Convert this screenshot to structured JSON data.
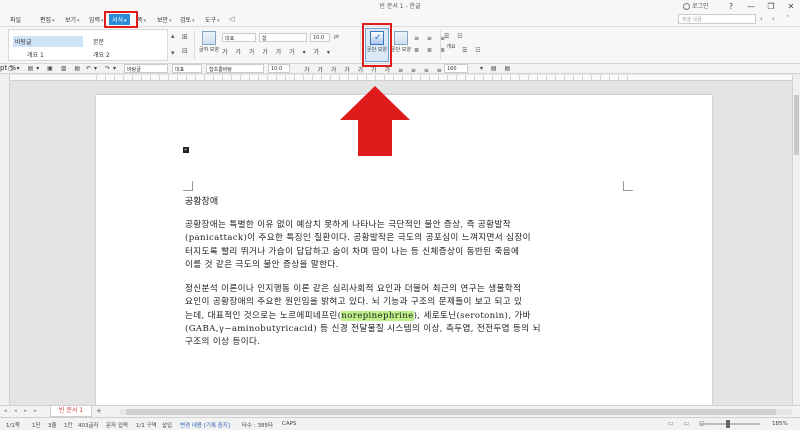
{
  "titlebar": {
    "title": "빈 문서 1 - 한글",
    "login": "로그인",
    "buttons": [
      "?",
      "—",
      "❐",
      "✕"
    ]
  },
  "menubar": {
    "items": [
      {
        "label": "파일",
        "arrow": false,
        "active": false
      },
      {
        "label": "편집",
        "arrow": true,
        "active": false
      },
      {
        "label": "보기",
        "arrow": true,
        "active": false
      },
      {
        "label": "입력",
        "arrow": true,
        "active": false
      },
      {
        "label": "서식",
        "arrow": true,
        "active": true
      },
      {
        "label": "쪽",
        "arrow": true,
        "active": false
      },
      {
        "label": "보안",
        "arrow": true,
        "active": false
      },
      {
        "label": "검토",
        "arrow": true,
        "active": false
      },
      {
        "label": "도구",
        "arrow": true,
        "active": false
      }
    ],
    "search_placeholder": "찾을 내용"
  },
  "ribbon": {
    "styles": [
      {
        "label": "바탕글",
        "selected": true
      },
      {
        "label": "본문",
        "selected": false
      },
      {
        "label": "개요 1",
        "selected": false
      },
      {
        "label": "개요 2",
        "selected": false
      }
    ],
    "char_label": "글자 모양",
    "font_lang": "대표",
    "font_name": "함",
    "font_size": "10.0",
    "font_unit": "pt",
    "para_btn": "문단 모양",
    "para_btn2": "문단 모양",
    "style_btn": "스타일",
    "style_btn2": "개요"
  },
  "fmtbar": {
    "style": "바탕글",
    "lang": "대표",
    "font": "함초롬바탕",
    "size": "10.0",
    "unit": "pt",
    "line_spacing": "160",
    "unit2": "%"
  },
  "document": {
    "title": "공황장애",
    "para1": [
      "공황장애는 특별한 이유 없이 예상치 못하게 나타나는 극단적인 불안 증상, 즉 공황발작",
      "(panicattack)이 주요한 특징인 질환이다. 공황발작은 극도의 공포심이 느껴지면서 심장이",
      "터지도록 빨리 뛰거나 가슴이 답답하고 숨이 차며 땀이 나는 등 신체증상이 동반된 죽음에",
      "이를 것 같은 극도의 불안 증상을 말한다."
    ],
    "para2": [
      "정신분석 이론이나 인지행동 이론 같은 심리사회적 요인과 더불어 최근의 연구는 생물학적",
      "요인이 공황장애의 주요한 원인임을 밝혀고 있다. 뇌 기능과 구조의 문제들이 보고 되고 있",
      {
        "before": "는데, 대표적인 것으로는 노르에피네프린(",
        "highlight": "norepinephrine",
        "after": "), 세로토닌(serotonin), 가바"
      },
      "(GABA,γ−aminobutyricacid) 등 신경 전달물질 시스템의 이상, 측두엽, 전전두엽 등의 뇌",
      "구조의 이상 등이다."
    ]
  },
  "tabs": {
    "doc_tab": "빈 문서 1",
    "add": "+"
  },
  "status": {
    "items": [
      "1/1쪽",
      "1단",
      "3줄",
      "1칸",
      "403글자",
      "문자 입력",
      "1/1 구역",
      "삽입",
      "변경 내용 [기록 중지]",
      "타수 : 385타",
      "CAPS"
    ],
    "zoom": "185%"
  },
  "colors": {
    "accent": "#2a8bd8",
    "annotation": "#e01b1b",
    "highlight": "#bff08a"
  }
}
